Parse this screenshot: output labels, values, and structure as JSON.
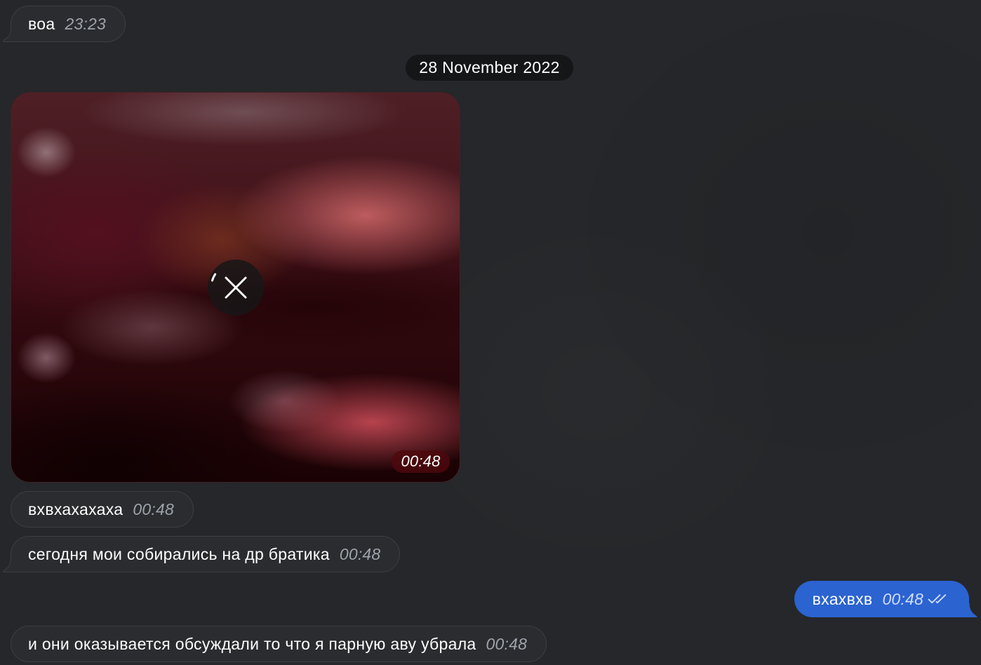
{
  "colors": {
    "background": "#25272a",
    "incoming_bubble": "#2a2c2f",
    "incoming_border": "#3c3e42",
    "outgoing_bubble": "#2b63d1",
    "date_pill": "#151618",
    "time_text": "#9ea3ab",
    "outgoing_time_text": "#cfdcff",
    "text": "#ffffff"
  },
  "timeline": [
    {
      "incoming": {
        "text": "воа",
        "time": "23:23"
      }
    },
    {
      "date_separator": "28 November 2022"
    },
    {
      "incoming_photo": {
        "time": "00:48",
        "overlay_icon": "close-icon",
        "progress_icon": "loading-arc-icon"
      }
    },
    {
      "incoming": {
        "text": "вхвхахахаха",
        "time": "00:48"
      }
    },
    {
      "incoming": {
        "text": "сегодня мои собирались на др братика",
        "time": "00:48"
      }
    },
    {
      "outgoing": {
        "text": "вхахвхв",
        "time": "00:48",
        "status_icon": "double-check-icon"
      }
    },
    {
      "incoming": {
        "text": "и они оказывается обсуждали то что я парную аву убрала",
        "time": "00:48"
      }
    }
  ]
}
